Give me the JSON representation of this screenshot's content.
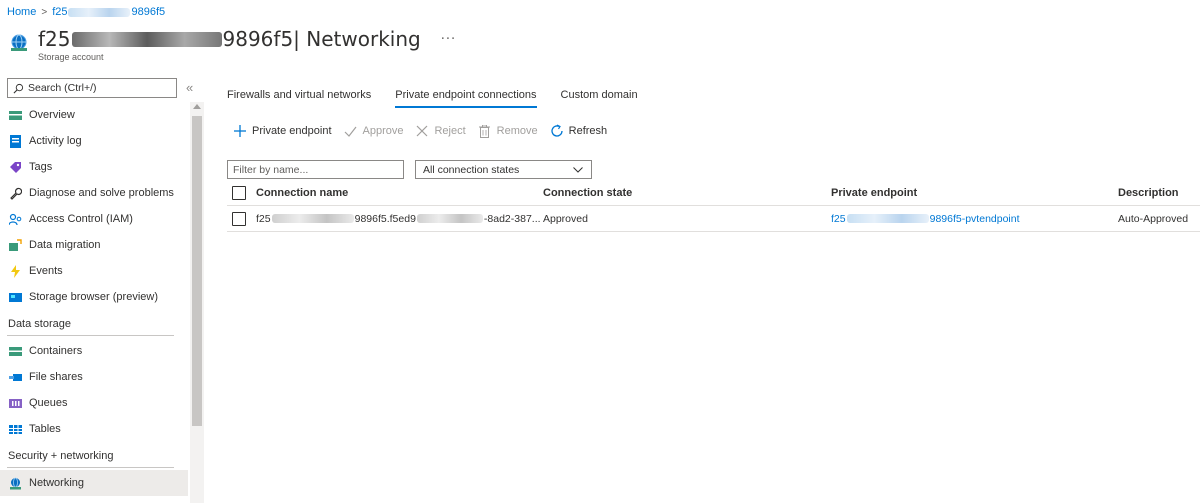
{
  "breadcrumb": {
    "home": "Home",
    "separator": ">",
    "resource_prefix": "f25",
    "resource_suffix": "9896f5"
  },
  "header": {
    "title_prefix": "f25",
    "title_suffix": "9896f5",
    "title_section": " | Networking",
    "more": "···",
    "subtitle": "Storage account"
  },
  "sidebar": {
    "search_placeholder": "Search (Ctrl+/)",
    "collapse": "«",
    "items": [
      {
        "label": "Overview",
        "icon": "overview-icon",
        "color": "#3a9a7a"
      },
      {
        "label": "Activity log",
        "icon": "activity-log-icon",
        "color": "#0078d4"
      },
      {
        "label": "Tags",
        "icon": "tag-icon",
        "color": "#7b45c7"
      },
      {
        "label": "Diagnose and solve problems",
        "icon": "wrench-icon",
        "color": "#323130"
      },
      {
        "label": "Access Control (IAM)",
        "icon": "people-icon",
        "color": "#0078d4"
      },
      {
        "label": "Data migration",
        "icon": "data-migration-icon",
        "color": "#3a9a7a"
      },
      {
        "label": "Events",
        "icon": "lightning-icon",
        "color": "#f2c811"
      },
      {
        "label": "Storage browser (preview)",
        "icon": "storage-browser-icon",
        "color": "#0078d4"
      }
    ],
    "section_data_storage": "Data storage",
    "data_storage_items": [
      {
        "label": "Containers",
        "icon": "containers-icon",
        "color": "#3a9a7a"
      },
      {
        "label": "File shares",
        "icon": "file-shares-icon",
        "color": "#0078d4"
      },
      {
        "label": "Queues",
        "icon": "queues-icon",
        "color": "#8661c5"
      },
      {
        "label": "Tables",
        "icon": "tables-icon",
        "color": "#0078d4"
      }
    ],
    "section_security": "Security + networking",
    "security_items": [
      {
        "label": "Networking",
        "icon": "networking-icon",
        "color": "#0078d4",
        "active": true
      }
    ]
  },
  "tabs": [
    {
      "label": "Firewalls and virtual networks",
      "active": false
    },
    {
      "label": "Private endpoint connections",
      "active": true
    },
    {
      "label": "Custom domain",
      "active": false
    }
  ],
  "toolbar": {
    "add": "Private endpoint",
    "approve": "Approve",
    "reject": "Reject",
    "remove": "Remove",
    "refresh": "Refresh"
  },
  "filters": {
    "name_placeholder": "Filter by name...",
    "state_selected": "All connection states"
  },
  "table": {
    "columns": [
      "Connection name",
      "Connection state",
      "Private endpoint",
      "Description"
    ],
    "rows": [
      {
        "name_prefix": "f25",
        "name_mid": "9896f5.f5ed9",
        "name_suffix": "-8ad2-387...",
        "state": "Approved",
        "endpoint_prefix": "f25",
        "endpoint_suffix": "9896f5-pvtendpoint",
        "description": "Auto-Approved"
      }
    ]
  },
  "colors": {
    "accent": "#0078d4",
    "text": "#323130",
    "disabled": "#a19f9d",
    "active_nav": "#edebe9"
  }
}
